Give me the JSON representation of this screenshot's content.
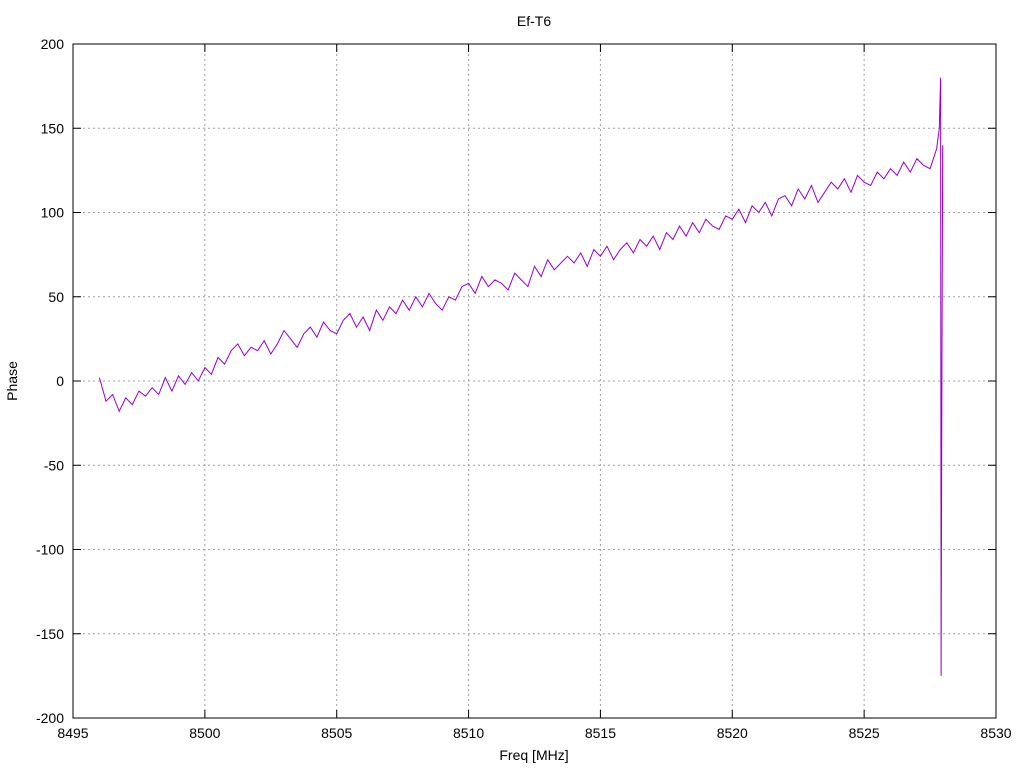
{
  "chart_data": {
    "type": "line",
    "title": "Ef-T6",
    "xlabel": "Freq [MHz]",
    "ylabel": "Phase",
    "xlim": [
      8495,
      8530
    ],
    "ylim": [
      -200,
      200
    ],
    "xticks": [
      8495,
      8500,
      8505,
      8510,
      8515,
      8520,
      8525,
      8530
    ],
    "yticks": [
      -200,
      -150,
      -100,
      -50,
      0,
      50,
      100,
      150,
      200
    ],
    "grid": true,
    "line_color": "#9400d3",
    "series": [
      {
        "name": "Ef-T6",
        "x_start": 8496,
        "x_step": 0.25,
        "values": [
          2,
          -12,
          -8,
          -18,
          -10,
          -14,
          -6,
          -9,
          -4,
          -8,
          2,
          -6,
          3,
          -2,
          5,
          0,
          8,
          4,
          14,
          10,
          18,
          22,
          15,
          20,
          18,
          24,
          16,
          22,
          30,
          25,
          20,
          28,
          32,
          26,
          35,
          30,
          28,
          36,
          40,
          32,
          38,
          30,
          42,
          36,
          44,
          40,
          48,
          42,
          50,
          44,
          52,
          46,
          42,
          50,
          48,
          56,
          58,
          52,
          62,
          56,
          60,
          58,
          54,
          64,
          60,
          56,
          68,
          62,
          72,
          66,
          70,
          74,
          70,
          76,
          68,
          78,
          74,
          80,
          72,
          78,
          82,
          76,
          84,
          80,
          86,
          78,
          88,
          84,
          92,
          86,
          94,
          88,
          96,
          92,
          90,
          98,
          96,
          102,
          94,
          104,
          100,
          106,
          98,
          108,
          110,
          104,
          114,
          108,
          116,
          106,
          112,
          118,
          114,
          120,
          112,
          122,
          118,
          116,
          124,
          120,
          126,
          122,
          130,
          124,
          132,
          128,
          126,
          138
        ],
        "tail": [
          [
            8527.85,
            150
          ],
          [
            8527.9,
            180
          ],
          [
            8527.92,
            -175
          ],
          [
            8527.95,
            5
          ],
          [
            8527.98,
            140
          ]
        ]
      }
    ]
  }
}
